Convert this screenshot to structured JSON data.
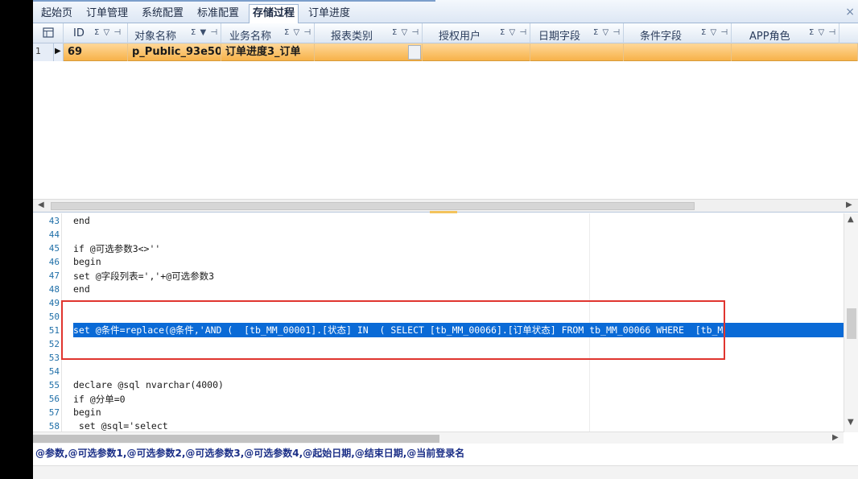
{
  "tabs": [
    {
      "label": "起始页"
    },
    {
      "label": "订单管理"
    },
    {
      "label": "系统配置"
    },
    {
      "label": "标准配置"
    },
    {
      "label": "存储过程"
    },
    {
      "label": "订单进度"
    }
  ],
  "active_tab": "存储过程",
  "tab_close_glyph": "×",
  "grid": {
    "columns": [
      {
        "label": "ID",
        "icons": "Σ ▽ ⊣"
      },
      {
        "label": "对象名称",
        "icons": "Σ ▼ ⊣"
      },
      {
        "label": "业务名称",
        "icons": "Σ ▽ ⊣"
      },
      {
        "label": "报表类别",
        "icons": "Σ ▽ ⊣"
      },
      {
        "label": "授权用户",
        "icons": "Σ ▽ ⊣"
      },
      {
        "label": "日期字段",
        "icons": "Σ ▽ ⊣"
      },
      {
        "label": "条件字段",
        "icons": "Σ ▽ ⊣"
      },
      {
        "label": "APP角色",
        "icons": "Σ ▽ ⊣"
      }
    ],
    "row": {
      "index": "1",
      "indicator": "▶",
      "id": "69",
      "object_name": "p_Public_93e50",
      "business_name": "订单进度3_订单"
    }
  },
  "editor": {
    "lines": [
      {
        "no": "43",
        "text": "end"
      },
      {
        "no": "44",
        "text": ""
      },
      {
        "no": "45",
        "text": "if @可选参数3<>''"
      },
      {
        "no": "46",
        "text": "begin"
      },
      {
        "no": "47",
        "text": "set @字段列表=','+@可选参数3"
      },
      {
        "no": "48",
        "text": "end"
      },
      {
        "no": "49",
        "text": ""
      },
      {
        "no": "50",
        "text": ""
      },
      {
        "no": "51",
        "text": "set @条件=replace(@条件,'AND (  [tb_MM_00001].[状态] IN  ( SELECT [tb_MM_00066].[订单状态] FROM tb_MM_00066 WHERE  [tb_M"
      },
      {
        "no": "52",
        "text": ""
      },
      {
        "no": "53",
        "text": ""
      },
      {
        "no": "54",
        "text": ""
      },
      {
        "no": "55",
        "text": "declare @sql nvarchar(4000)"
      },
      {
        "no": "56",
        "text": "if @分单=0"
      },
      {
        "no": "57",
        "text": "begin"
      },
      {
        "no": "58",
        "text": " set @sql='select"
      }
    ],
    "selected_line": "51"
  },
  "params_text": "@参数,@可选参数1,@可选参数2,@可选参数3,@可选参数4,@起始日期,@结束日期,@当前登录名"
}
